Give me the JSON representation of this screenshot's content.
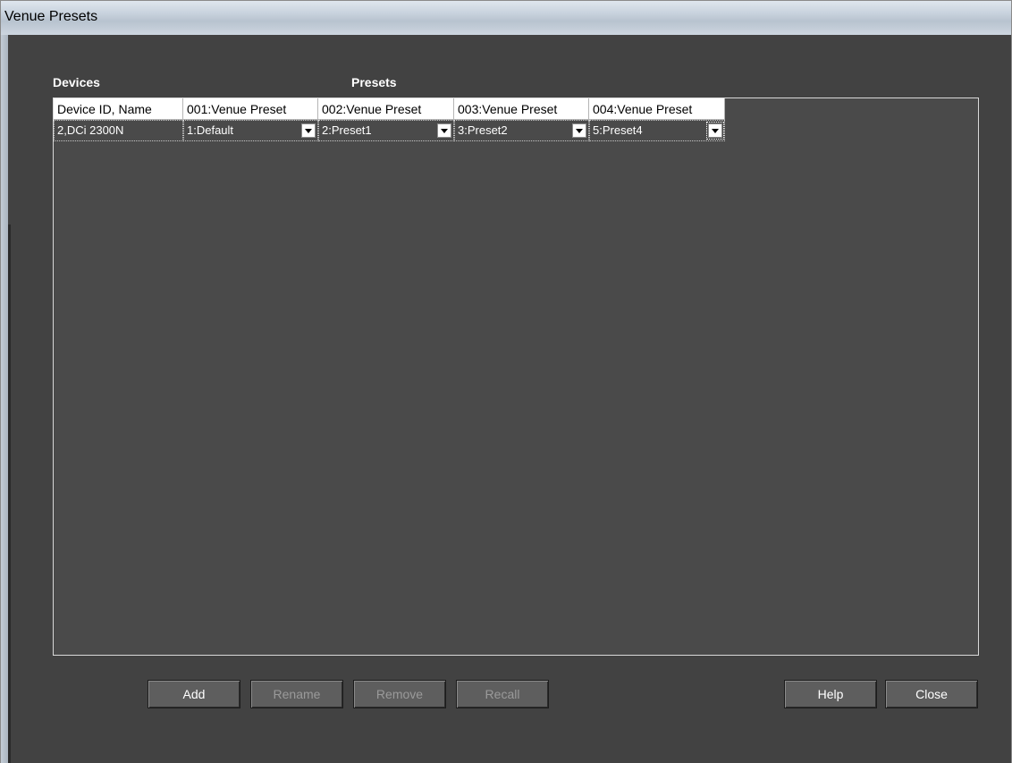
{
  "window": {
    "title": "Venue Presets"
  },
  "labels": {
    "devices": "Devices",
    "presets": "Presets"
  },
  "table": {
    "headers": [
      "Device ID, Name",
      "001:Venue Preset",
      "002:Venue Preset",
      "003:Venue Preset",
      "004:Venue Preset"
    ],
    "rows": [
      {
        "device": "2,DCi 2300N",
        "presets": [
          "1:Default",
          "2:Preset1",
          "3:Preset2",
          "5:Preset4"
        ]
      }
    ]
  },
  "buttons": {
    "add": "Add",
    "rename": "Rename",
    "remove": "Remove",
    "recall": "Recall",
    "help": "Help",
    "close": "Close"
  },
  "colors": {
    "background": "#424242",
    "grid_background": "#4a4a4a",
    "header_background": "#ffffff",
    "enabled_text": "#ffffff",
    "disabled_text": "#9a9a9a"
  }
}
